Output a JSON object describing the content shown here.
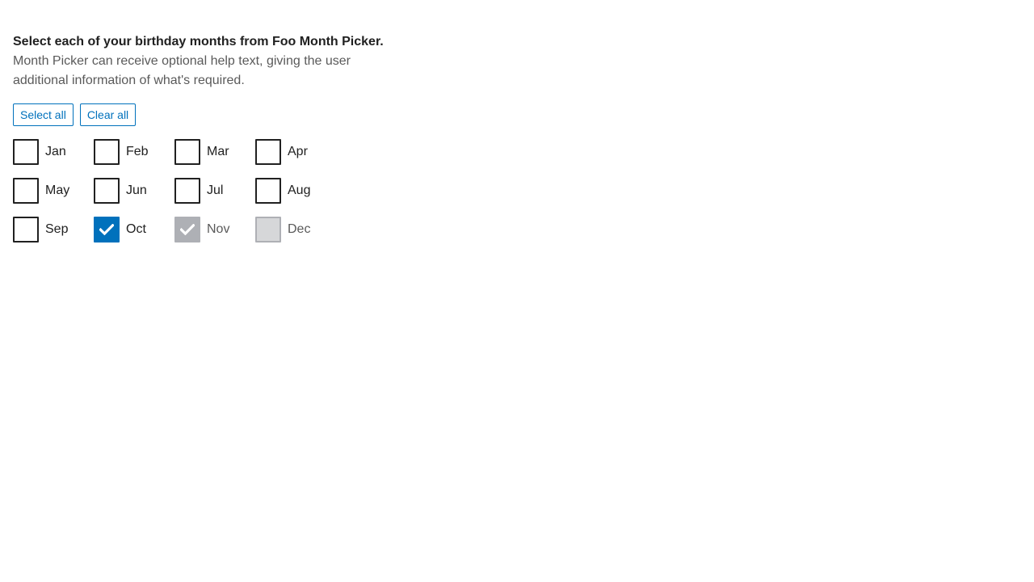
{
  "picker": {
    "legend": "Select each of your birthday months from Foo Month Picker.",
    "help": "Month Picker can receive optional help text, giving the user additional information of what's required.",
    "select_all_label": "Select all",
    "clear_all_label": "Clear all",
    "months": [
      {
        "label": "Jan",
        "state": "unchecked"
      },
      {
        "label": "Feb",
        "state": "unchecked"
      },
      {
        "label": "Mar",
        "state": "unchecked"
      },
      {
        "label": "Apr",
        "state": "unchecked"
      },
      {
        "label": "May",
        "state": "unchecked"
      },
      {
        "label": "Jun",
        "state": "unchecked"
      },
      {
        "label": "Jul",
        "state": "unchecked"
      },
      {
        "label": "Aug",
        "state": "unchecked"
      },
      {
        "label": "Sep",
        "state": "unchecked"
      },
      {
        "label": "Oct",
        "state": "checked"
      },
      {
        "label": "Nov",
        "state": "disabled-checked"
      },
      {
        "label": "Dec",
        "state": "disabled"
      }
    ]
  },
  "colors": {
    "accent": "#0071bc",
    "text": "#212121",
    "help_text": "#5a5a5a",
    "disabled_fill": "#aeb0b5",
    "disabled_empty_fill": "#d6d7d9"
  },
  "icons": {
    "check": "checkmark-icon"
  }
}
